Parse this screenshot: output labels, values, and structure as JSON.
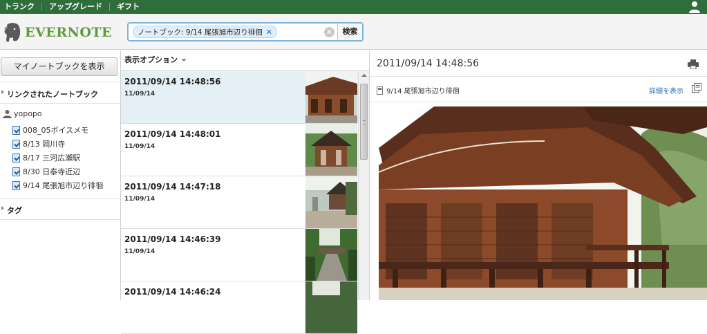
{
  "topbar": {
    "items": [
      "トランク",
      "アップグレード",
      "ギフト"
    ]
  },
  "header": {
    "logo_text": "EVERNOTE",
    "search_token": "ノートブック: 9/14 尾張旭市辺り徘徊",
    "search_button": "検索"
  },
  "sidebar": {
    "my_notebooks_button": "マイノートブックを表示",
    "linked_heading": "リンクされたノートブック",
    "owner": "yopopo",
    "notebooks": [
      "008_05ボイスメモ",
      "8/13 岡川寺",
      "8/17 三河広瀬駅",
      "8/30 日泰寺近辺",
      "9/14 尾張旭市辺り徘徊"
    ],
    "tags_heading": "タグ"
  },
  "list": {
    "options_label": "表示オプション",
    "notes": [
      {
        "title": "2011/09/14 14:48:56",
        "date": "11/09/14"
      },
      {
        "title": "2011/09/14 14:48:01",
        "date": "11/09/14"
      },
      {
        "title": "2011/09/14 14:47:18",
        "date": "11/09/14"
      },
      {
        "title": "2011/09/14 14:46:39",
        "date": "11/09/14"
      },
      {
        "title": "2011/09/14 14:46:24",
        "date": ""
      }
    ]
  },
  "detail": {
    "title": "2011/09/14 14:48:56",
    "notebook": "9/14 尾張旭市辺り徘徊",
    "show_details": "詳細を表示"
  },
  "colors": {
    "topbar": "#2f6e3b",
    "logo_green": "#5f9a3a",
    "link_blue": "#2a6fb0",
    "selected_row": "#e5f0f6"
  }
}
